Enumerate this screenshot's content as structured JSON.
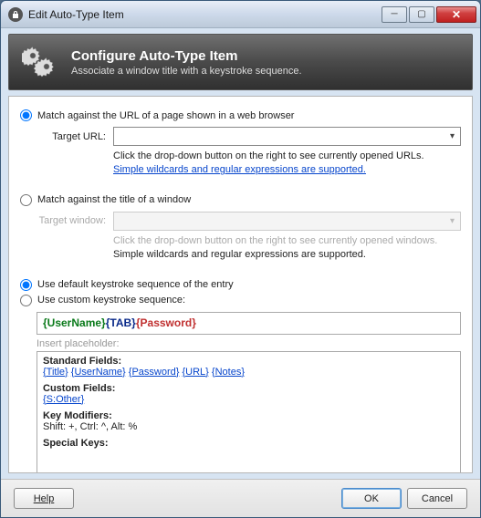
{
  "window": {
    "title": "Edit Auto-Type Item"
  },
  "header": {
    "title": "Configure Auto-Type Item",
    "subtitle": "Associate a window title with a keystroke sequence."
  },
  "match": {
    "url_radio_label": "Match against the URL of a page shown in a web browser",
    "target_url_label": "Target URL:",
    "target_url_value": "",
    "url_hint": "Click the drop-down button on the right to see currently opened URLs.",
    "url_hint_link": "Simple wildcards and regular expressions are supported.",
    "title_radio_label": "Match against the title of a window",
    "target_window_label": "Target window:",
    "target_window_value": "",
    "window_hint1": "Click the drop-down button on the right to see currently opened windows.",
    "window_hint2": "Simple wildcards and regular expressions are supported."
  },
  "sequence": {
    "default_radio_label": "Use default keystroke sequence of the entry",
    "custom_radio_label": "Use custom keystroke sequence:",
    "tokens": {
      "user": "{UserName}",
      "tab": "{TAB}",
      "pwd": "{Password}"
    },
    "insert_label": "Insert placeholder:"
  },
  "placeholders": {
    "standard_title": "Standard Fields:",
    "standard": [
      "{Title}",
      "{UserName}",
      "{Password}",
      "{URL}",
      "{Notes}"
    ],
    "custom_title": "Custom Fields:",
    "custom": [
      "{S:Other}"
    ],
    "keymod_title": "Key Modifiers:",
    "keymod_text": "Shift: +, Ctrl: ^, Alt: %",
    "special_title": "Special Keys:"
  },
  "buttons": {
    "help": "Help",
    "ok": "OK",
    "cancel": "Cancel"
  }
}
